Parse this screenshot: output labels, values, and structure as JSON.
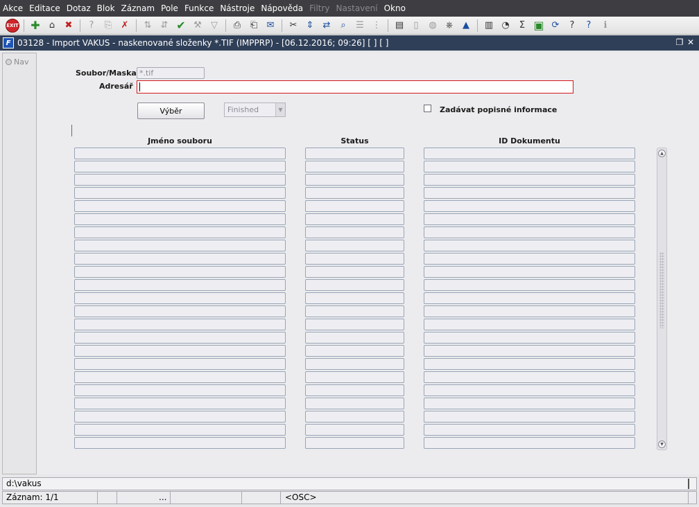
{
  "menu": [
    "Akce",
    "Editace",
    "Dotaz",
    "Blok",
    "Záznam",
    "Pole",
    "Funkce",
    "Nástroje",
    "Nápověda",
    "Filtry",
    "Nastavení",
    "Okno"
  ],
  "menu_disabled": [
    "Filtry",
    "Nastavení"
  ],
  "toolbar": {
    "exit_label": "EXIT",
    "icons": [
      "exit-icon",
      "add-record-icon",
      "insert-record-icon",
      "delete-record-icon",
      "query-enter-icon",
      "query-execute-icon",
      "query-cancel-icon",
      "sort-asc-icon",
      "sort-desc-icon",
      "checkmark-icon",
      "wrench-icon",
      "filter-icon",
      "print-icon",
      "print-preview-icon",
      "email-icon",
      "cut-icon",
      "move-icon",
      "transfer-icon",
      "zoom-icon",
      "list-icon",
      "tree-icon",
      "clipboard-icon",
      "document-icon",
      "globe-icon",
      "wheel-icon",
      "hat-icon",
      "chart-icon",
      "clock-icon",
      "sum-icon",
      "excel-icon",
      "refresh-icon",
      "help-context-icon",
      "help-icon",
      "info-icon"
    ]
  },
  "window": {
    "title": "03128 - Import VAKUS - naskenované složenky *.TIF (IMPPRP) - [06.12.2016; 09:26]  [ ]  [ ]",
    "app_icon_letter": "F"
  },
  "side": {
    "nav_label": "Nav"
  },
  "form": {
    "mask_label": "Soubor/Maska",
    "mask_value": "*.tif",
    "address_label": "Adresář",
    "address_value": "",
    "select_button": "Výběr",
    "status_value": "Finished",
    "checkbox_label": "Zadávat popisné informace",
    "checkbox_checked": false
  },
  "table": {
    "columns": [
      "Jméno souboru",
      "Status",
      "ID Dokumentu"
    ],
    "row_count": 23
  },
  "status": {
    "hint": "d:\\vakus",
    "record": "Záznam: 1/1",
    "ellipsis": "...",
    "mode": "<OSC>"
  },
  "colors": {
    "menubar": "#3e3e42",
    "titlebar": "#2f3f58",
    "required_border": "#d01818"
  }
}
